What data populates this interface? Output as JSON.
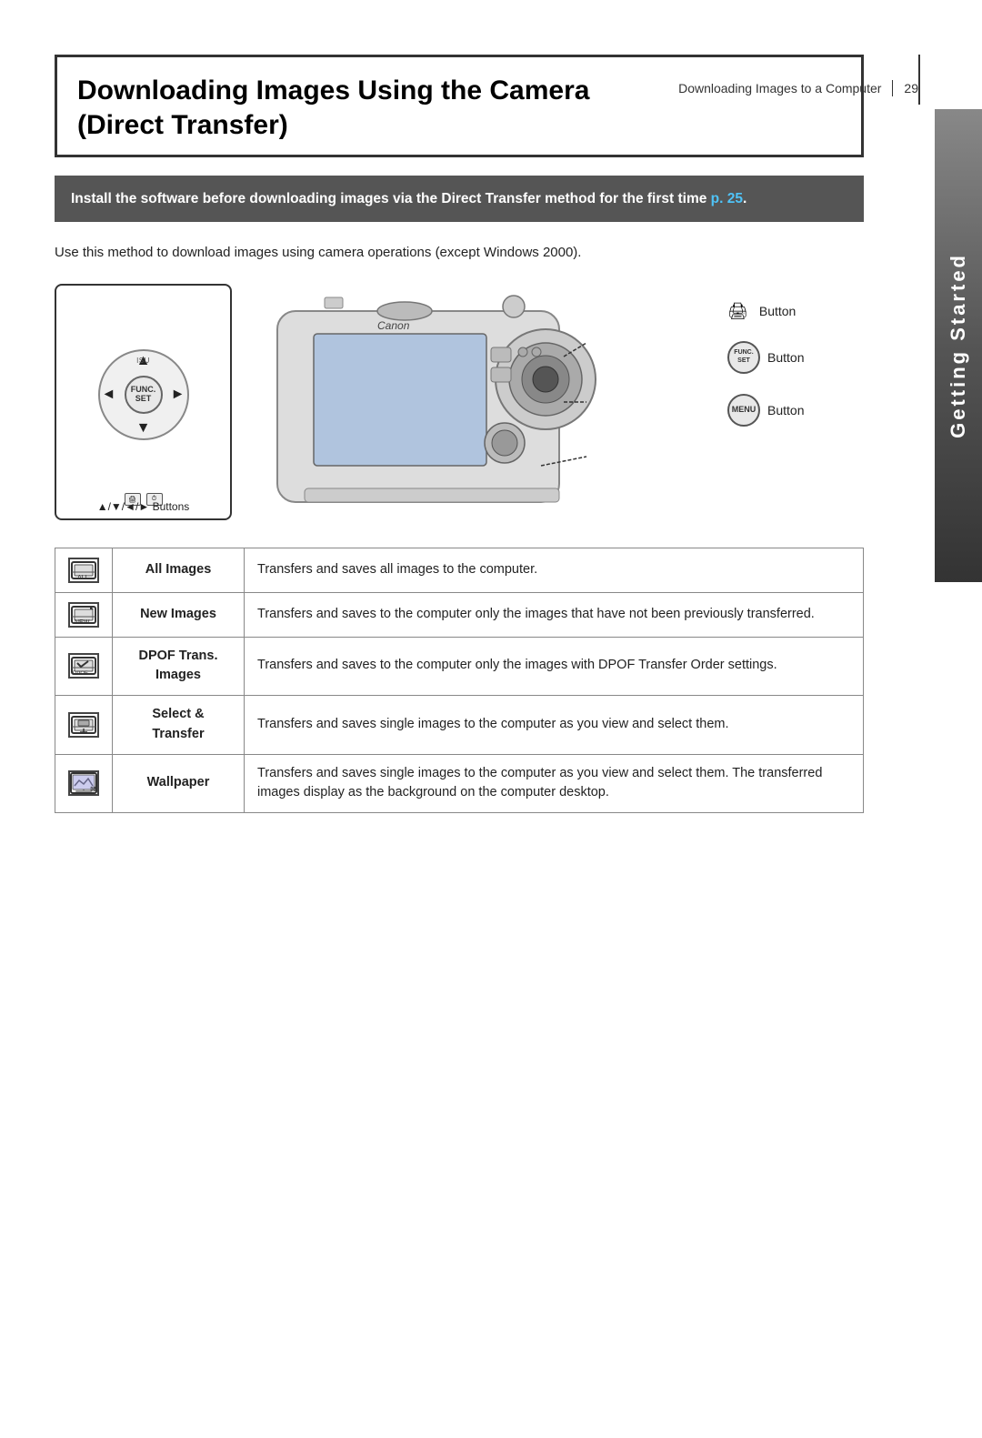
{
  "page": {
    "number": "29",
    "chapter": "Getting Started",
    "header_ref": "Downloading Images to a Computer"
  },
  "title": {
    "line1": "Downloading Images Using the Camera",
    "line2": "(Direct Transfer)"
  },
  "warning": {
    "text": "Install the software before downloading images via the Direct Transfer method for the first time ",
    "link_text": "p. 25",
    "link_suffix": "."
  },
  "body_text": "Use this method to download images using camera operations (except Windows 2000).",
  "diagram": {
    "control_labels": {
      "isu": "ISU",
      "func_set": [
        "FUNC.",
        "SET"
      ],
      "arrows": "▲/▼/◄/► Buttons"
    },
    "buttons": [
      {
        "label": "Button",
        "icon_text": "🖨"
      },
      {
        "label": "Button",
        "icon_text": "FUNC.\nSET"
      },
      {
        "label": "Button",
        "icon_text": "MENU"
      }
    ]
  },
  "table": {
    "rows": [
      {
        "icon_type": "all-images",
        "label": "All Images",
        "description": "Transfers and saves all images to the computer."
      },
      {
        "icon_type": "new-images",
        "label": "New Images",
        "description": "Transfers and saves to the computer only the images that have not been previously transferred."
      },
      {
        "icon_type": "dpof-trans",
        "label": "DPOF Trans.\nImages",
        "description": "Transfers and saves to the computer only the images with DPOF Transfer Order settings."
      },
      {
        "icon_type": "select-transfer",
        "label": "Select & Transfer",
        "description": "Transfers and saves single images to the computer as you view and select them."
      },
      {
        "icon_type": "wallpaper",
        "label": "Wallpaper",
        "description": "Transfers and saves single images to the computer as you view and select them. The transferred images display as the background on the computer desktop."
      }
    ]
  }
}
